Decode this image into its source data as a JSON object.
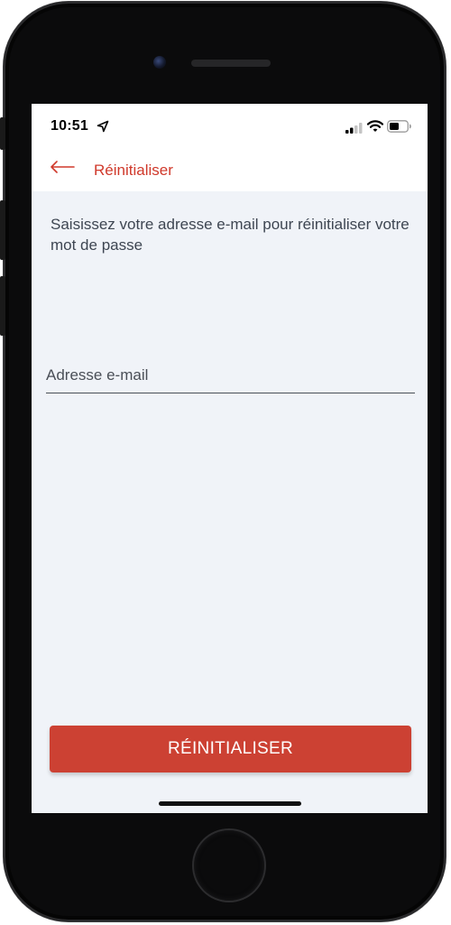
{
  "status_bar": {
    "time": "10:51",
    "location_icon": "location-arrow-icon",
    "signal_icon": "cellular-signal-icon",
    "wifi_icon": "wifi-icon",
    "battery_icon": "battery-icon"
  },
  "app_bar": {
    "back_icon": "arrow-left-icon",
    "title": "Réinitialiser"
  },
  "main": {
    "instructions": "Saisissez votre adresse e-mail pour réinitialiser votre mot de passe",
    "email_input": {
      "placeholder": "Adresse e-mail",
      "value": ""
    },
    "reset_button_label": "RÉINITIALISER"
  },
  "colors": {
    "accent": "#d0392b",
    "button_bg": "#cc4133",
    "screen_bg": "#f0f3f8",
    "text": "#3e4652"
  }
}
